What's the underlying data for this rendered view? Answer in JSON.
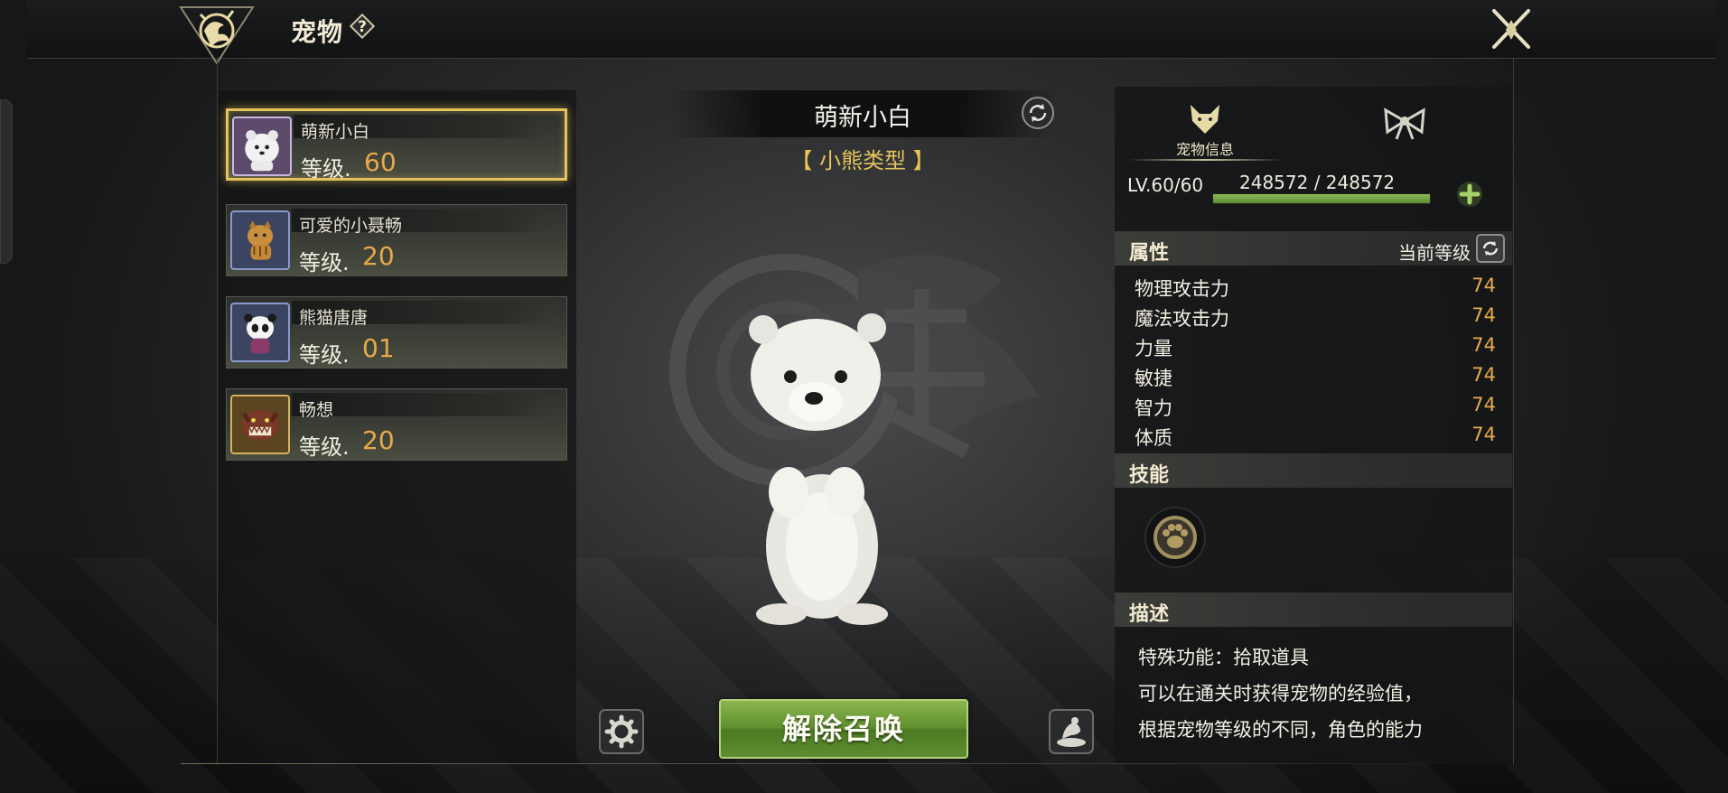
{
  "header": {
    "title": "宠物"
  },
  "pets": [
    {
      "name": "萌新小白",
      "level_label": "等级.",
      "level": "60",
      "selected": true
    },
    {
      "name": "可爱的小聂畅",
      "level_label": "等级.",
      "level": "20",
      "selected": false
    },
    {
      "name": "熊猫唐唐",
      "level_label": "等级.",
      "level": "01",
      "selected": false
    },
    {
      "name": "畅想",
      "level_label": "等级.",
      "level": "20",
      "selected": false
    }
  ],
  "center": {
    "name": "萌新小白",
    "type": "【 小熊类型 】",
    "dismiss_label": "解除召唤"
  },
  "info": {
    "tab_info_label": "宠物信息",
    "level_text": "LV.60/60",
    "exp_text": "248572 / 248572",
    "exp_progress": 1.0,
    "attributes_title": "属性",
    "current_level_label": "当前等级",
    "stats": [
      {
        "name": "物理攻击力",
        "value": "74"
      },
      {
        "name": "魔法攻击力",
        "value": "74"
      },
      {
        "name": "力量",
        "value": "74"
      },
      {
        "name": "敏捷",
        "value": "74"
      },
      {
        "name": "智力",
        "value": "74"
      },
      {
        "name": "体质",
        "value": "74"
      }
    ],
    "skills_title": "技能",
    "description_title": "描述",
    "description": [
      "特殊功能：拾取道具",
      "可以在通关时获得宠物的经验值，",
      "根据宠物等级的不同，角色的能力"
    ]
  },
  "colors": {
    "level_value": "#e9a94b",
    "selected_border": "#e3c35a",
    "button_green": "#5f8f2e",
    "exp_green": "#8cba58"
  },
  "icons": [
    "dragon-emblem-icon",
    "help-icon",
    "close-icon",
    "refresh-icon",
    "settings-icon",
    "feed-pet-icon",
    "fox-head-icon",
    "bow-icon",
    "plus-icon",
    "paw-skill-icon"
  ]
}
